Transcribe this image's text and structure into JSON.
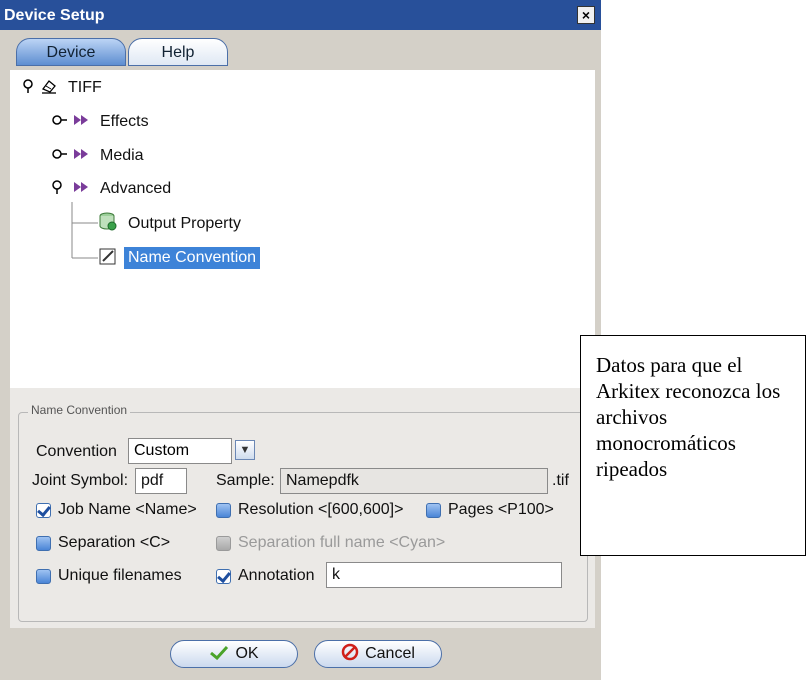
{
  "window": {
    "title": "Device Setup",
    "close_label": "×"
  },
  "tabs": [
    {
      "label": "Device",
      "active": true
    },
    {
      "label": "Help",
      "active": false
    }
  ],
  "tree": {
    "root": {
      "label": "TIFF",
      "icon": "printer-icon"
    },
    "children": [
      {
        "label": "Effects",
        "icon": "double-arrow-icon"
      },
      {
        "label": "Media",
        "icon": "double-arrow-icon"
      },
      {
        "label": "Advanced",
        "icon": "double-arrow-icon"
      }
    ],
    "advanced_children": [
      {
        "label": "Output Property",
        "icon": "database-icon"
      },
      {
        "label": "Name Convention",
        "icon": "edit-icon",
        "selected": true
      }
    ]
  },
  "name_convention": {
    "group_title": "Name Convention",
    "convention_label": "Convention",
    "convention_value": "Custom",
    "joint_symbol_label": "Joint Symbol:",
    "joint_symbol_value": "pdf",
    "sample_label": "Sample:",
    "sample_value": "Namepdfk",
    "sample_suffix": ".tif",
    "checkboxes": [
      {
        "label": "Job Name <Name>",
        "checked": true,
        "disabled": false
      },
      {
        "label": "Resolution <[600,600]>",
        "checked": false,
        "disabled": false
      },
      {
        "label": "Pages <P100>",
        "checked": false,
        "disabled": false
      },
      {
        "label": "Separation <C>",
        "checked": false,
        "disabled": false
      },
      {
        "label": "Separation full name <Cyan>",
        "checked": false,
        "disabled": true
      },
      {
        "label": "Unique filenames",
        "checked": false,
        "disabled": false
      },
      {
        "label": "Annotation",
        "checked": true,
        "disabled": false
      }
    ],
    "annotation_value": "k"
  },
  "buttons": {
    "ok_label": "OK",
    "cancel_label": "Cancel"
  },
  "note": "Datos para que el Arkitex reconozca los archivos monocromáticos ripeados",
  "colors": {
    "titlebar": "#28509a",
    "selection": "#3d83d8",
    "dialog_bg": "#d4d0c8"
  }
}
